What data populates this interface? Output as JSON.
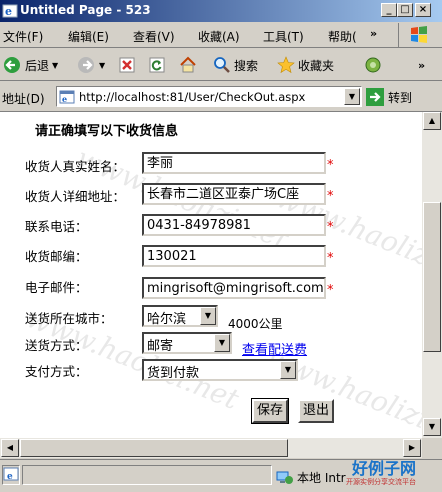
{
  "window": {
    "title": "Untitled Page - 523",
    "min_glyph": "_",
    "max_glyph": "□",
    "close_glyph": "×"
  },
  "menu": {
    "items": [
      "文件(F)",
      "编辑(E)",
      "查看(V)",
      "收藏(A)",
      "工具(T)",
      "帮助("
    ],
    "more": "»"
  },
  "toolbar": {
    "back_label": "后退",
    "search_label": "搜索",
    "favorites_label": "收藏夹",
    "more": "»"
  },
  "address": {
    "label": "地址(D)",
    "url": "http://localhost:81/User/CheckOut.aspx",
    "go_label": "转到"
  },
  "form": {
    "title": "请正确填写以下收货信息",
    "name_label": "收货人真实姓名：",
    "name_value": "李丽",
    "address_label": "收货人详细地址：",
    "address_value": "长春市二道区亚泰广场C座",
    "phone_label": "联系电话：",
    "phone_value": "0431-84978981",
    "zip_label": "收货邮编：",
    "zip_value": "130021",
    "email_label": "电子邮件：",
    "email_value": "mingrisoft@mingrisoft.com",
    "city_label": "送货所在城市：",
    "city_value": "哈尔滨",
    "distance": "4000公里",
    "ship_label": "送货方式：",
    "ship_value": "邮寄",
    "ship_fee_link": "查看配送费",
    "pay_label": "支付方式：",
    "pay_value": "货到付款",
    "required_mark": "*",
    "save_label": "保存",
    "exit_label": "退出"
  },
  "watermark": "www.haolizi.net",
  "status": {
    "zone_label": "本地 Intr"
  },
  "brand": {
    "name": "好例子网",
    "sub": "开源实例分享交流平台"
  },
  "colors": {
    "title_start": "#0a246a",
    "title_end": "#a6caf0",
    "required": "#e00000",
    "link": "#0000ee"
  }
}
